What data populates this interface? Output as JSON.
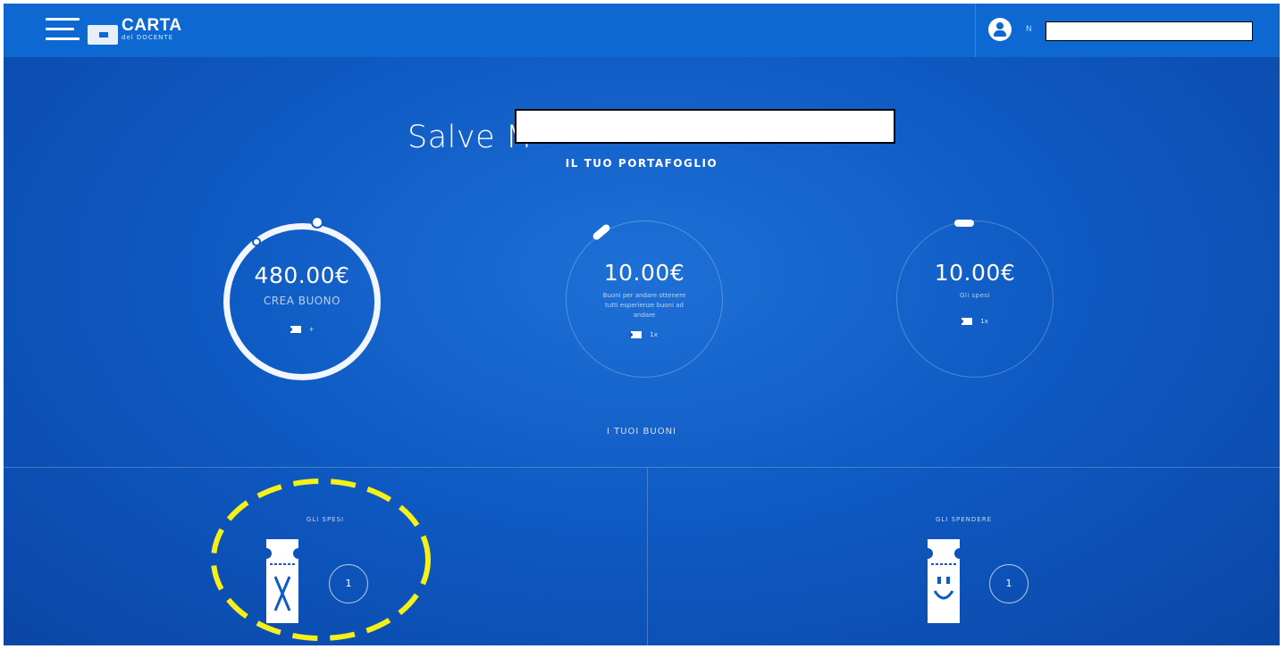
{
  "header": {
    "brand_title": "CARTA",
    "brand_subtitle": "del DOCENTE",
    "user_initial": "N",
    "menu_icon": "hamburger-icon",
    "user_icon": "user-circle-icon"
  },
  "hero": {
    "greeting": "Salve M",
    "wallet_title": "IL TUO PORTAFOGLIO"
  },
  "wallet": [
    {
      "amount": "480.00€",
      "label": "CREA BUONO",
      "count": "+"
    },
    {
      "amount": "10.00€",
      "label": "Buoni per andare ottenere tutti esperienze buoni ad andare",
      "count": "1x"
    },
    {
      "amount": "10.00€",
      "label": "Gli spesi",
      "count": "1x"
    }
  ],
  "vouchers_title": "I TUOI BUONI",
  "panels": [
    {
      "title": "GLI SPESI",
      "count": "1",
      "icon": "used-ticket-icon"
    },
    {
      "title": "GLI SPENDERE",
      "count": "1",
      "icon": "smiley-ticket-icon"
    }
  ],
  "colors": {
    "background": "#0f5bc4",
    "header": "#0d68d2",
    "highlight": "#f5f018"
  }
}
